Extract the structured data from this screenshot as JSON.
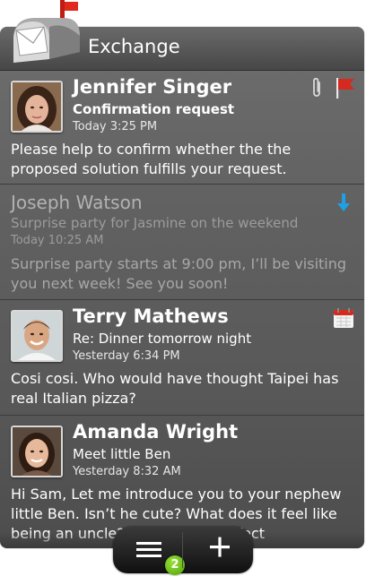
{
  "header": {
    "title": "Exchange"
  },
  "messages": [
    {
      "sender": "Jennifer Singer",
      "subject": "Confirmation request",
      "time": "Today 3:25 PM",
      "body": "Please help to confirm whether the the proposed solution fulfills your request.",
      "icons": [
        "paperclip-icon",
        "red-flag-icon"
      ]
    },
    {
      "sender": "Joseph Watson",
      "subject": "Surprise party for Jasmine on the weekend",
      "time": "Today 10:25 AM",
      "body": "Surprise party starts at 9:00 pm, I’ll be visiting you next week! See you soon!",
      "icons": [
        "down-arrow-icon"
      ]
    },
    {
      "sender": "Terry Mathews",
      "subject": "Re: Dinner tomorrow night",
      "time": "Yesterday 6:34 PM",
      "body": "Cosi cosi. Who would have thought Taipei has real Italian pizza?",
      "icons": [
        "calendar-icon"
      ]
    },
    {
      "sender": "Amanda Wright",
      "subject": "Meet little Ben",
      "time": "Yesterday 8:32 AM",
      "body": "Hi Sam, Let me introduce you to your nephew little Ben. Isn’t he cute? What does it feel like being an uncle? ... can be a perfect",
      "icons": []
    }
  ],
  "bottom_bar": {
    "unread_badge": "2"
  },
  "colors": {
    "flag": "#d42a1f",
    "arrow": "#1ea0e6",
    "badge": "#6cc01a"
  }
}
